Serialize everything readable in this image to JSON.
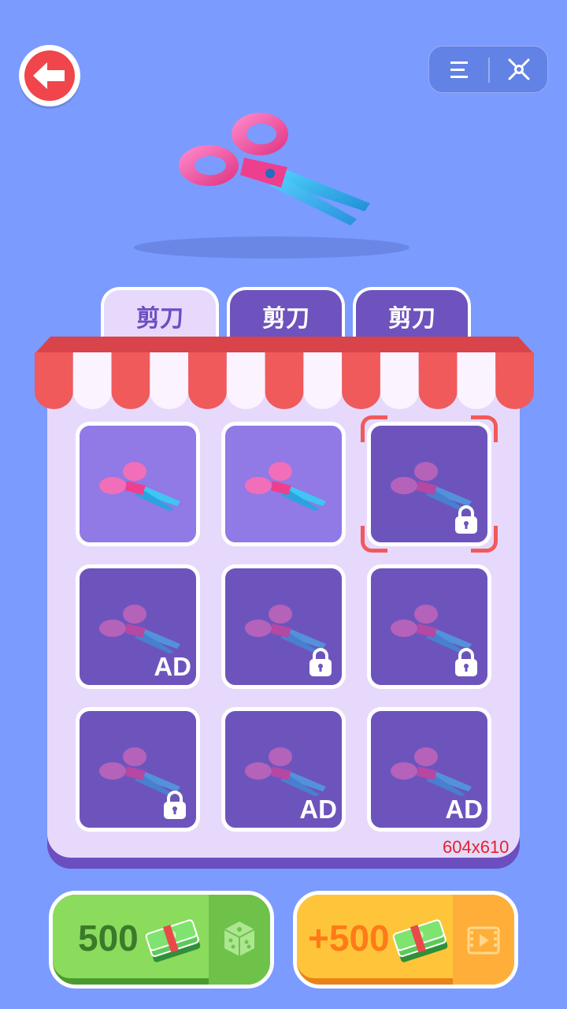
{
  "tabs": [
    {
      "label": "剪刀",
      "active": true
    },
    {
      "label": "剪刀",
      "active": false
    },
    {
      "label": "剪刀",
      "active": false
    }
  ],
  "items": [
    {
      "state": "owned",
      "badge": "",
      "lock": false,
      "selected": false
    },
    {
      "state": "owned",
      "badge": "",
      "lock": false,
      "selected": false
    },
    {
      "state": "locked",
      "badge": "",
      "lock": true,
      "selected": true
    },
    {
      "state": "locked",
      "badge": "AD",
      "lock": false,
      "selected": false
    },
    {
      "state": "locked",
      "badge": "",
      "lock": true,
      "selected": false
    },
    {
      "state": "locked",
      "badge": "",
      "lock": true,
      "selected": false
    },
    {
      "state": "locked",
      "badge": "",
      "lock": true,
      "selected": false
    },
    {
      "state": "locked",
      "badge": "AD",
      "lock": false,
      "selected": false
    },
    {
      "state": "locked",
      "badge": "AD",
      "lock": false,
      "selected": false
    }
  ],
  "debug_label": "604x610",
  "buy_button": {
    "price": "500",
    "icon": "dice-icon"
  },
  "ad_button": {
    "reward": "+500",
    "icon": "video-icon"
  },
  "colors": {
    "background": "#7b9bff",
    "panel": "#e7d9fb",
    "awning_red": "#f05a5a",
    "tile_owned": "#9179e6",
    "tile_locked": "#6d54bd",
    "green_button": "#8bdc5c",
    "orange_button": "#ffc53a"
  }
}
